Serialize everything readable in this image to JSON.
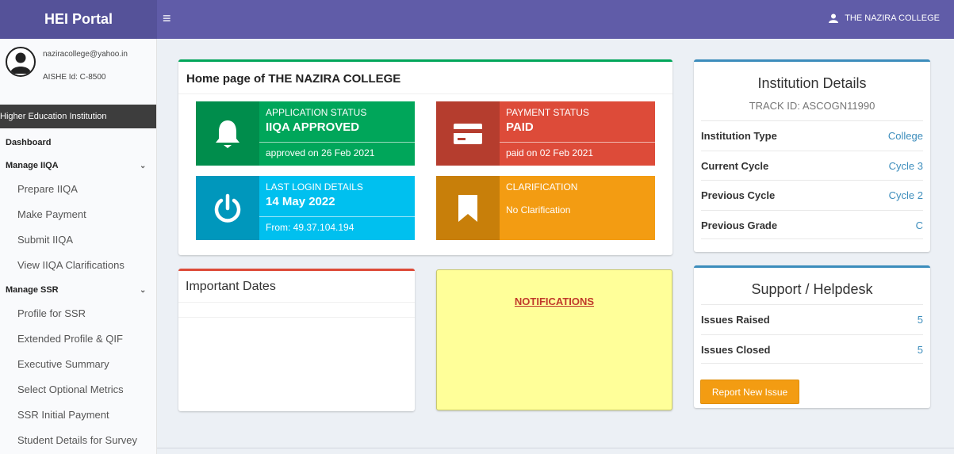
{
  "header": {
    "brand": "HEI Portal",
    "menu_icon": "≡",
    "user_name": "THE NAZIRA COLLEGE",
    "colors": {
      "topbar": "#605ca8",
      "brand_bg": "#555299"
    }
  },
  "sidebar": {
    "email": "naziracollege@yahoo.in",
    "aishe": "AISHE Id: C-8500",
    "section_header": "Higher Education Institution",
    "items": [
      {
        "label": "Dashboard",
        "level": "top"
      },
      {
        "label": "Manage IIQA",
        "level": "top",
        "expandable": true
      },
      {
        "label": "Prepare IIQA",
        "level": "sub"
      },
      {
        "label": "Make Payment",
        "level": "sub"
      },
      {
        "label": "Submit IIQA",
        "level": "sub"
      },
      {
        "label": "View IIQA Clarifications",
        "level": "sub"
      },
      {
        "label": "Manage SSR",
        "level": "top",
        "expandable": true
      },
      {
        "label": "Profile for SSR",
        "level": "sub"
      },
      {
        "label": "Extended Profile & QIF",
        "level": "sub"
      },
      {
        "label": "Executive Summary",
        "level": "sub"
      },
      {
        "label": "Select Optional Metrics",
        "level": "sub"
      },
      {
        "label": "SSR Initial Payment",
        "level": "sub"
      },
      {
        "label": "Student Details for Survey",
        "level": "sub"
      }
    ]
  },
  "home": {
    "title": "Home page of THE NAZIRA COLLEGE",
    "boxes": {
      "application": {
        "label": "APPLICATION STATUS",
        "value": "IIQA APPROVED",
        "foot": "approved on 26 Feb 2021",
        "icon": "bell-icon",
        "color": "#00a65a"
      },
      "payment": {
        "label": "PAYMENT STATUS",
        "value": "PAID",
        "foot": "paid on 02 Feb 2021",
        "icon": "credit-card-icon",
        "color": "#dd4b39"
      },
      "login": {
        "label": "LAST LOGIN DETAILS",
        "value": "14 May 2022",
        "foot": "From: 49.37.104.194",
        "icon": "power-icon",
        "color": "#00c0ef"
      },
      "clarification": {
        "label": "CLARIFICATION",
        "value": "No Clarification",
        "icon": "bookmark-icon",
        "color": "#f39c12"
      }
    }
  },
  "dates": {
    "title": "Important Dates"
  },
  "notifications": {
    "title": "NOTIFICATIONS"
  },
  "institution": {
    "title": "Institution Details",
    "track_id": "TRACK ID: ASCOGN11990",
    "rows": [
      {
        "key": "Institution Type",
        "value": "College"
      },
      {
        "key": "Current Cycle",
        "value": "Cycle 3"
      },
      {
        "key": "Previous Cycle",
        "value": "Cycle 2"
      },
      {
        "key": "Previous Grade",
        "value": "C"
      }
    ]
  },
  "support": {
    "title": "Support / Helpdesk",
    "rows": [
      {
        "key": "Issues Raised",
        "value": "5"
      },
      {
        "key": "Issues Closed",
        "value": "5"
      }
    ],
    "button": "Report New Issue"
  }
}
